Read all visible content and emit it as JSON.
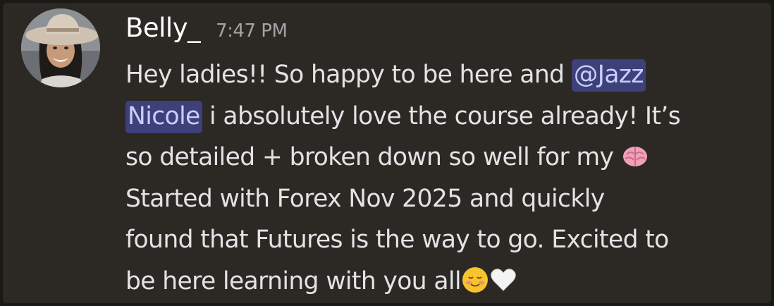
{
  "message": {
    "author": "Belly_",
    "timestamp": "7:47 PM",
    "lines": [
      {
        "before": "Hey ladies!! So happy to be here and ",
        "mention": "@Jazz"
      },
      {
        "mention": "Nicole",
        "after": " i absolutely love the course already! It’s"
      },
      {
        "text": "so detailed + broken down so well for my ",
        "emoji": "brain"
      },
      {
        "text": "Started with Forex Nov 2025 and quickly"
      },
      {
        "text": "found that Futures is the way to go. Excited to"
      },
      {
        "text": "be here learning with you all",
        "emojis": [
          "smiling-face",
          "white-heart"
        ]
      }
    ]
  },
  "colors": {
    "background": "#2c2925",
    "mention_bg": "#3e407a",
    "mention_text": "#c9cdfb",
    "text": "#e3e3e5",
    "timestamp": "#a3a3a6"
  }
}
